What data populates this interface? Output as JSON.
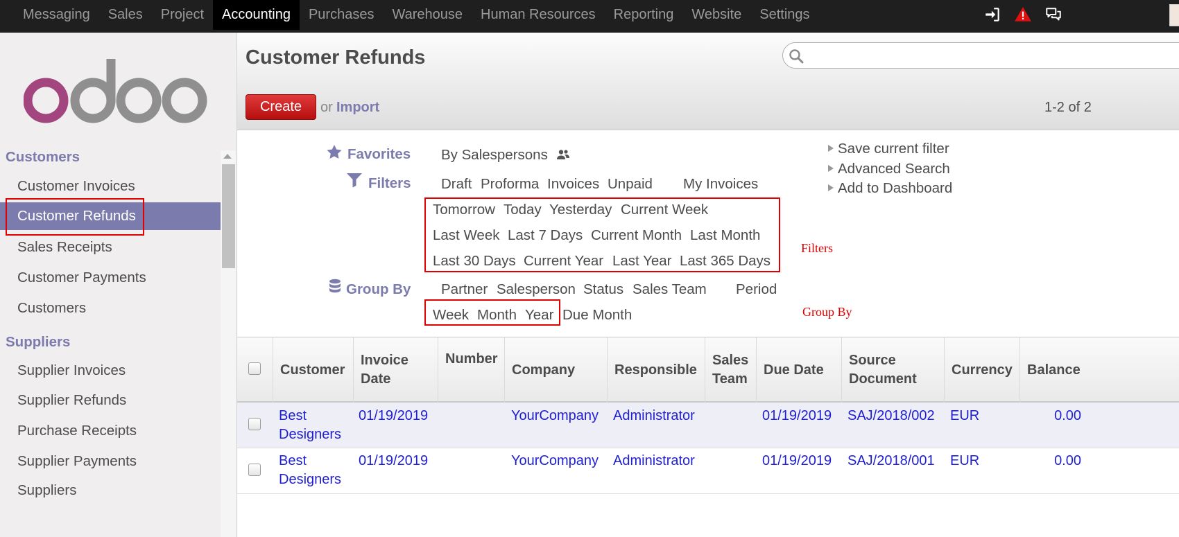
{
  "topbar": {
    "menu": [
      "Messaging",
      "Sales",
      "Project",
      "Accounting",
      "Purchases",
      "Warehouse",
      "Human Resources",
      "Reporting",
      "Website",
      "Settings"
    ],
    "active_menu": "Accounting",
    "icons": [
      "sign-in-icon",
      "warning-icon",
      "chat-icon",
      "avatar"
    ]
  },
  "sidebar": {
    "logo_text": "odoo",
    "sections": [
      {
        "title": "Customers",
        "items": [
          "Customer Invoices",
          "Customer Refunds",
          "Sales Receipts",
          "Customer Payments",
          "Customers"
        ]
      },
      {
        "title": "Suppliers",
        "items": [
          "Supplier Invoices",
          "Supplier Refunds",
          "Purchase Receipts",
          "Supplier Payments",
          "Suppliers"
        ]
      }
    ],
    "active_item": "Customer Refunds"
  },
  "control_panel": {
    "title": "Customer Refunds",
    "search": {
      "value": "",
      "placeholder": ""
    },
    "create_label": "Create",
    "or_label": "or",
    "import_label": "Import",
    "pager": "1-2 of 2"
  },
  "search_drawer": {
    "favorites": {
      "label": "Favorites",
      "options": [
        "By Salespersons"
      ]
    },
    "filters": {
      "label": "Filters",
      "row1": [
        "Draft",
        "Proforma",
        "Invoices",
        "Unpaid",
        "My Invoices"
      ],
      "date_row1": [
        "Tomorrow",
        "Today",
        "Yesterday",
        "Current Week"
      ],
      "date_row2": [
        "Last Week",
        "Last 7 Days",
        "Current Month",
        "Last Month"
      ],
      "date_row3": [
        "Last 30 Days",
        "Current Year",
        "Last Year",
        "Last 365 Days"
      ]
    },
    "group_by": {
      "label": "Group By",
      "row1": [
        "Partner",
        "Salesperson",
        "Status",
        "Sales Team",
        "Period"
      ],
      "row2": [
        "Week",
        "Month",
        "Year",
        "Due Month"
      ]
    },
    "actions": [
      "Save current filter",
      "Advanced Search",
      "Add to Dashboard"
    ],
    "annotations": {
      "filters": "Filters",
      "group_by": "Group By"
    },
    "annotation_color": "#e00000"
  },
  "table": {
    "columns": [
      "Customer",
      "Invoice Date",
      "Number",
      "Company",
      "Responsible",
      "Sales Team",
      "Due Date",
      "Source Document",
      "Currency",
      "Balance"
    ],
    "rows": [
      {
        "customer": "Best Designers",
        "invoice_date": "01/19/2019",
        "number": "",
        "company": "YourCompany",
        "responsible": "Administrator",
        "sales_team": "",
        "due_date": "01/19/2019",
        "source_document": "SAJ/2018/002",
        "currency": "EUR",
        "balance": "0.00"
      },
      {
        "customer": "Best Designers",
        "invoice_date": "01/19/2019",
        "number": "",
        "company": "YourCompany",
        "responsible": "Administrator",
        "sales_team": "",
        "due_date": "01/19/2019",
        "source_document": "SAJ/2018/001",
        "currency": "EUR",
        "balance": "0.00"
      }
    ]
  },
  "colors": {
    "accent": "#7c7bad",
    "create_button": "#c31414",
    "link": "#1f1fd1",
    "topbar": "#1f1f1f"
  }
}
